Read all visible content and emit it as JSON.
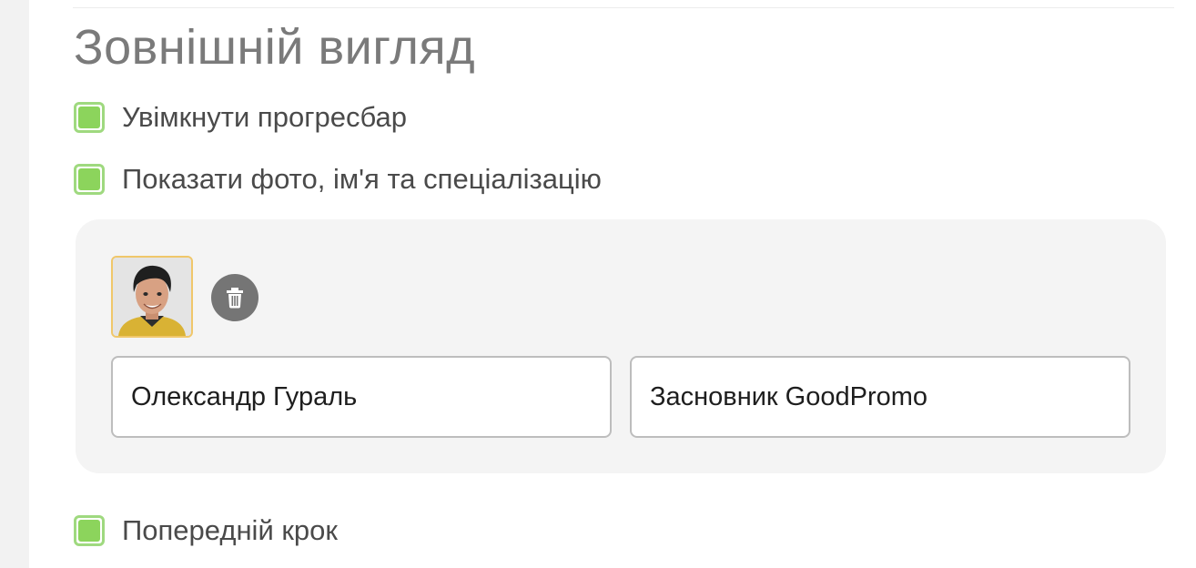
{
  "appearance": {
    "title": "Зовнішній вигляд",
    "options": {
      "progressbar": {
        "label": "Увімкнути прогресбар",
        "checked": true
      },
      "show_profile": {
        "label": "Показати фото, ім'я та спеціалізацію",
        "checked": true
      },
      "previous_step": {
        "label": "Попередній крок",
        "checked": true
      }
    },
    "profile": {
      "avatar_icon": "person-photo",
      "delete_icon": "trash-icon",
      "name_value": "Олександр Гураль",
      "specialization_value": "Засновник GoodPromo"
    }
  },
  "colors": {
    "checkbox_fill": "#8cd45c",
    "checkbox_border": "#9fd97f",
    "avatar_border": "#f0c76a",
    "delete_button": "#757575",
    "card_background": "#f4f4f4",
    "title_text": "#7a7a7a"
  }
}
